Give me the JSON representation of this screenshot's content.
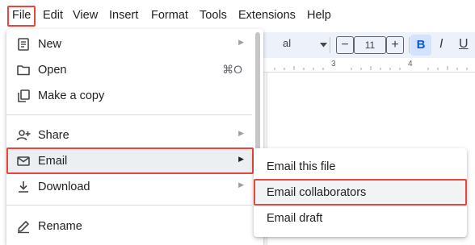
{
  "menubar": {
    "items": [
      "File",
      "Edit",
      "View",
      "Insert",
      "Format",
      "Tools",
      "Extensions",
      "Help"
    ]
  },
  "toolbar": {
    "font_partial": "al",
    "minus": "−",
    "font_size": "11",
    "plus": "+",
    "bold": "B"
  },
  "ruler": {
    "label_3": "3",
    "label_4": "4"
  },
  "file_menu": {
    "items": [
      {
        "label": "New",
        "icon": "document-icon",
        "has_submenu": true
      },
      {
        "label": "Open",
        "icon": "folder-icon",
        "shortcut": "⌘O"
      },
      {
        "label": "Make a copy",
        "icon": "copy-icon"
      },
      {
        "label": "Share",
        "icon": "share-person-icon",
        "has_submenu": true
      },
      {
        "label": "Email",
        "icon": "envelope-icon",
        "has_submenu": true,
        "selected": true
      },
      {
        "label": "Download",
        "icon": "download-icon",
        "has_submenu": true
      },
      {
        "label": "Rename",
        "icon": "pencil-icon"
      }
    ]
  },
  "email_submenu": {
    "items": [
      {
        "label": "Email this file"
      },
      {
        "label": "Email collaborators",
        "highlighted": true
      },
      {
        "label": "Email draft"
      }
    ]
  },
  "colors": {
    "highlight_border": "#e8453c",
    "selected_bg": "#eceff1",
    "bold_bg": "#d3e3fd",
    "bold_text": "#0b57d0"
  }
}
